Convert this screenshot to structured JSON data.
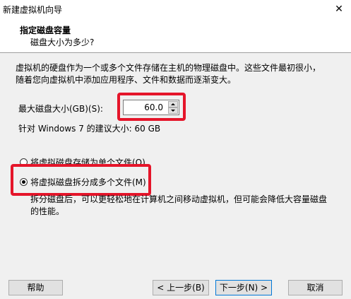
{
  "window": {
    "title": "新建虚拟机向导",
    "close_glyph": "✕"
  },
  "header": {
    "title": "指定磁盘容量",
    "subtitle": "磁盘大小为多少?"
  },
  "main": {
    "description": "虚拟机的硬盘作为一个或多个文件存储在主机的物理磁盘中。这些文件最初很小，随着您向虚拟机中添加应用程序、文件和数据而逐渐变大。",
    "max_size_label": "最大磁盘大小(GB)(S):",
    "max_size_value": "60.0",
    "recommended": "针对 Windows 7 的建议大小: 60 GB",
    "options": [
      {
        "label": "将虚拟磁盘存储为单个文件(O)",
        "selected": false
      },
      {
        "label": "将虚拟磁盘拆分成多个文件(M)",
        "selected": true
      }
    ],
    "split_description": "拆分磁盘后，可以更轻松地在计算机之间移动虚拟机，但可能会降低大容量磁盘的性能。"
  },
  "footer": {
    "help": "帮助",
    "back": "< 上一步(B)",
    "next": "下一步(N) >",
    "cancel": "取消"
  },
  "colors": {
    "highlight": "#e5152a",
    "dialog_bg": "#f0f0f0",
    "default_button_border": "#0078d7"
  }
}
